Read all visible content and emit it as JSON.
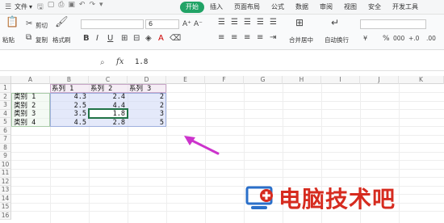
{
  "menu": {
    "file_label": "文件",
    "tabs": [
      "开始",
      "插入",
      "页面布局",
      "公式",
      "数据",
      "审阅",
      "视图",
      "安全",
      "开发工具"
    ],
    "active_tab": "开始"
  },
  "ribbon": {
    "paste": "粘贴",
    "cut": "剪切",
    "copy": "复制",
    "format_painter": "格式刷",
    "font_size": "6",
    "merge_center": "合并居中",
    "wrap_text": "自动换行",
    "currency": "¥",
    "percent": "%",
    "thousands": "000",
    "decimals_inc": "+.0",
    "decimals_dec": ".00"
  },
  "formula_bar": {
    "fx": "fx",
    "value": "1.8"
  },
  "sheet": {
    "columns": [
      "A",
      "B",
      "C",
      "D",
      "E",
      "F",
      "G",
      "H",
      "I",
      "J",
      "K"
    ],
    "rows": [
      "1",
      "2",
      "3",
      "4",
      "5",
      "6",
      "7",
      "8",
      "9",
      "10",
      "11",
      "12",
      "13",
      "14",
      "15",
      "16"
    ],
    "header_row": [
      "系列 1",
      "系列 2",
      "系列 3"
    ],
    "data": [
      {
        "label": "类别 1",
        "values": [
          "4.3",
          "2.4",
          "2"
        ]
      },
      {
        "label": "类别 2",
        "values": [
          "2.5",
          "4.4",
          "2"
        ]
      },
      {
        "label": "类别 3",
        "values": [
          "3.5",
          "1.8",
          "3"
        ]
      },
      {
        "label": "类别 4",
        "values": [
          "4.5",
          "2.8",
          "5"
        ]
      }
    ]
  },
  "watermark": {
    "text": "电脑技术吧",
    "color": "#d62b1f"
  },
  "colors": {
    "accent": "#21a366",
    "arrow": "#cc33cc"
  }
}
